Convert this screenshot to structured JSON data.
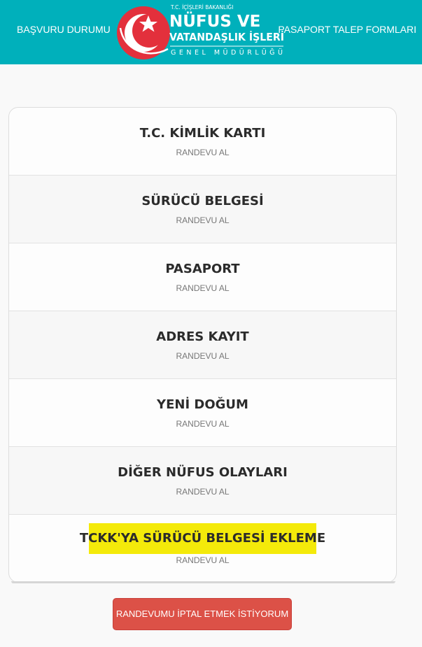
{
  "header": {
    "left_link": "BAŞVURU DURUMU",
    "right_link": "PASAPORT TALEP FORMLARI",
    "logo": {
      "ministry": "T.C. İÇİŞLERİ BAKANLIĞI",
      "line1": "NÜFUS VE",
      "line2": "VATANDAŞLIK İŞLERİ",
      "line3": "GENEL MÜDÜRLÜĞÜ"
    },
    "colors": {
      "bar": "#00b0bb",
      "logo_red": "#e3303c"
    }
  },
  "services": [
    {
      "title": "T.C. KİMLİK KARTI",
      "action": "RANDEVU AL"
    },
    {
      "title": "SÜRÜCÜ BELGESİ",
      "action": "RANDEVU AL"
    },
    {
      "title": "PASAPORT",
      "action": "RANDEVU AL"
    },
    {
      "title": "ADRES KAYIT",
      "action": "RANDEVU AL"
    },
    {
      "title": "YENİ DOĞUM",
      "action": "RANDEVU AL"
    },
    {
      "title": "DİĞER NÜFUS OLAYLARI",
      "action": "RANDEVU AL"
    },
    {
      "title": "TCKK'YA SÜRÜCÜ BELGESİ EKLEME",
      "action": "RANDEVU AL",
      "highlight_color": "#f4ea0a"
    }
  ],
  "cancel_button": {
    "label": "RANDEVUMU İPTAL ETMEK İSTİYORUM",
    "color": "#dc5147"
  }
}
